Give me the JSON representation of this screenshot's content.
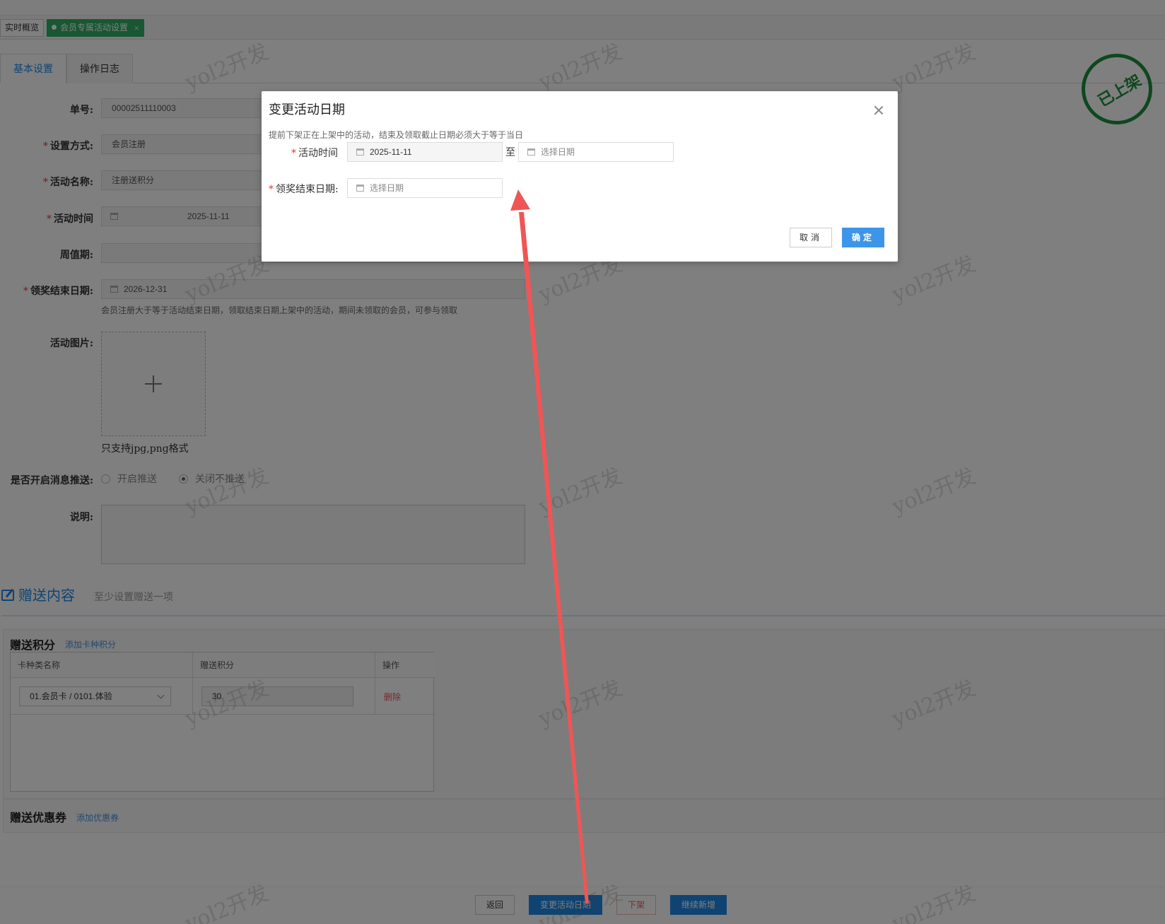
{
  "tabs": [
    {
      "label": "实时概览",
      "active": false
    },
    {
      "label": "会员专属活动设置",
      "active": true,
      "close": "×"
    }
  ],
  "subtabs": [
    {
      "label": "基本设置",
      "active": true
    },
    {
      "label": "操作日志",
      "active": false
    }
  ],
  "form": {
    "order_no": {
      "label": "单号:",
      "value": "00002511110003"
    },
    "setup_mode": {
      "label": "设置方式:",
      "value": "会员注册"
    },
    "activity_name": {
      "label": "活动名称:",
      "value": "注册送积分"
    },
    "activity_time": {
      "label": "活动时间",
      "value": "2025-11-11"
    },
    "period": {
      "label": "周值期:",
      "value": ""
    },
    "prize_end_date": {
      "label": "领奖结束日期:",
      "value": "2026-12-31",
      "hint": "会员注册大于等于活动结束日期，领取结束日期上架中的活动，期间未领取的会员，可参与领取"
    },
    "image": {
      "label": "活动图片:",
      "hint": "只支持jpg,png格式"
    },
    "push": {
      "label": "是否开启消息推送:",
      "options": [
        "开启推送",
        "关闭不推送"
      ],
      "selected": "关闭不推送"
    },
    "description": {
      "label": "说明:",
      "value": ""
    }
  },
  "gift_section": {
    "title": "赠送内容",
    "subtitle": "至少设置赠送一项",
    "points": {
      "title": "赠送积分",
      "add_link": "添加卡种积分",
      "columns": [
        "卡种类名称",
        "赠送积分",
        "操作"
      ],
      "rows": [
        {
          "card_type": "01.会员卡 / 0101.体验",
          "points": "30",
          "action": "删除"
        }
      ]
    },
    "coupons": {
      "title": "赠送优惠券",
      "add_link": "添加优惠券"
    }
  },
  "footer": {
    "back": "返回",
    "change_date": "变更活动日期",
    "offline": "下架",
    "continue_add": "继续新增"
  },
  "stamp": "已上架",
  "watermark": "yol2开发",
  "modal": {
    "title": "变更活动日期",
    "note": "提前下架正在上架中的活动，结束及领取截止日期必须大于等于当日",
    "activity_time_label": "活动时间",
    "start_date": "2025-11-11",
    "range_separator": "至",
    "end_placeholder": "选择日期",
    "prize_end_label": "领奖结束日期:",
    "prize_end_placeholder": "选择日期",
    "cancel": "取消",
    "confirm": "确定"
  },
  "colors": {
    "accent": "#1e88e5",
    "tab_active": "#2eaf62",
    "stamp": "#1e8e3e",
    "annotation_arrow": "#f05555",
    "danger": "#e55555"
  }
}
